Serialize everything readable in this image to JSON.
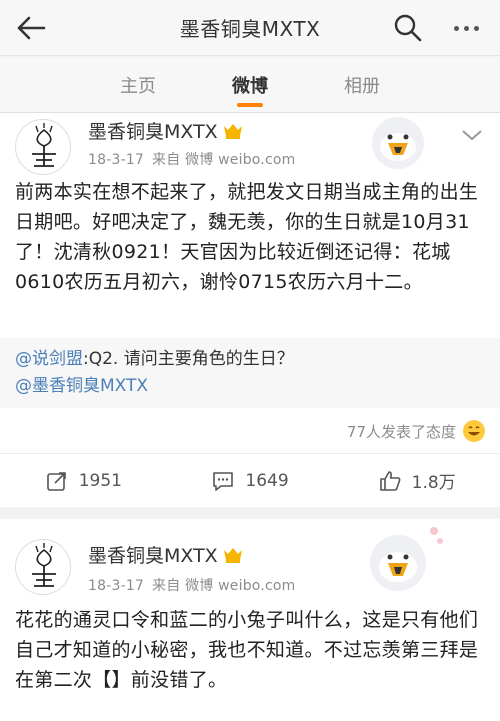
{
  "topbar": {
    "title": "墨香铜臭MXTX",
    "back_icon": "back-arrow-icon",
    "search_icon": "search-icon",
    "more_icon": "more-dots-icon"
  },
  "tabs": [
    {
      "label": "主页",
      "active": false
    },
    {
      "label": "微博",
      "active": true
    },
    {
      "label": "相册",
      "active": false
    }
  ],
  "posts": [
    {
      "username": "墨香铜臭MXTX",
      "date": "18-3-17",
      "source": "来自 微博 weibo.com",
      "content": "前两本实在想不起来了，就把发文日期当成主角的出生日期吧。好吧决定了，魏无羡，你的生日就是10月31了！沈清秋0921！天官因为比较近倒还记得：花城0610农历五月初六，谢怜0715农历六月十二。",
      "quote": {
        "author": "@说剑盟",
        "text": ":Q2. 请问主要角色的生日？",
        "mention": "@墨香铜臭MXTX"
      },
      "reactions": "77人发表了态度",
      "repost": "1951",
      "comment": "1649",
      "like": "1.8万"
    },
    {
      "username": "墨香铜臭MXTX",
      "date": "18-3-17",
      "source": "来自 微博 weibo.com",
      "content": "花花的通灵口令和蓝二的小兔子叫什么，这是只有他们自己才知道的小秘密，我也不知道。不过忘羡第三拜是在第二次【】前没错了。"
    }
  ],
  "colors": {
    "accent": "#ff8200",
    "link": "#4a7fb9"
  }
}
